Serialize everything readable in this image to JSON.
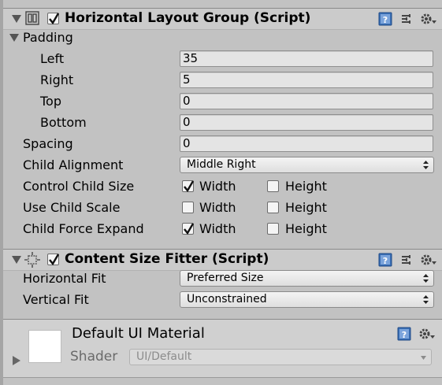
{
  "layout_group": {
    "title": "Horizontal Layout Group (Script)",
    "enabled": true,
    "padding": {
      "label": "Padding",
      "left_label": "Left",
      "left_value": "35",
      "right_label": "Right",
      "right_value": "5",
      "top_label": "Top",
      "top_value": "0",
      "bottom_label": "Bottom",
      "bottom_value": "0"
    },
    "spacing_label": "Spacing",
    "spacing_value": "0",
    "child_alignment_label": "Child Alignment",
    "child_alignment_value": "Middle Right",
    "control_child_size": {
      "label": "Control Child Size",
      "width_label": "Width",
      "width_checked": true,
      "height_label": "Height",
      "height_checked": false
    },
    "use_child_scale": {
      "label": "Use Child Scale",
      "width_label": "Width",
      "width_checked": false,
      "height_label": "Height",
      "height_checked": false
    },
    "child_force_expand": {
      "label": "Child Force Expand",
      "width_label": "Width",
      "width_checked": true,
      "height_label": "Height",
      "height_checked": false
    }
  },
  "size_fitter": {
    "title": "Content Size Fitter (Script)",
    "enabled": true,
    "horizontal_fit_label": "Horizontal Fit",
    "horizontal_fit_value": "Preferred Size",
    "vertical_fit_label": "Vertical Fit",
    "vertical_fit_value": "Unconstrained"
  },
  "material": {
    "title": "Default UI Material",
    "shader_label": "Shader",
    "shader_value": "UI/Default"
  },
  "icons": [
    "foldout-arrow-icon",
    "layout-group-icon",
    "size-fitter-icon",
    "help-book-icon",
    "presets-icon",
    "gear-icon",
    "dropdown-arrow-icon",
    "checkmark-icon"
  ],
  "colors": {
    "panel": "#c2c2c2",
    "header": "#cbcbcb",
    "help_icon": "#3a6fb5"
  }
}
